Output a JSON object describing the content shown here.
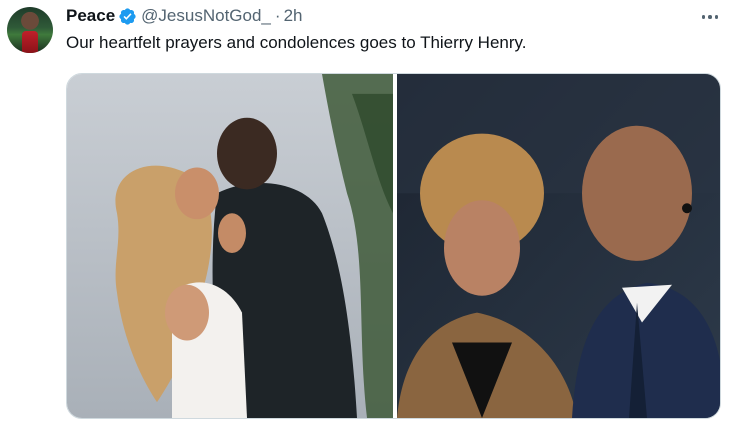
{
  "tweet": {
    "author_name": "Peace",
    "handle": "@JesusNotGod_",
    "separator": "·",
    "time": "2h",
    "text": "Our heartfelt prayers and condolences goes to Thierry Henry."
  },
  "icons": {
    "verified": "verified-badge-icon",
    "more": "more-dots-icon"
  },
  "colors": {
    "verified_blue": "#1d9bf0",
    "secondary_text": "#536471",
    "primary_text": "#0f1419"
  }
}
